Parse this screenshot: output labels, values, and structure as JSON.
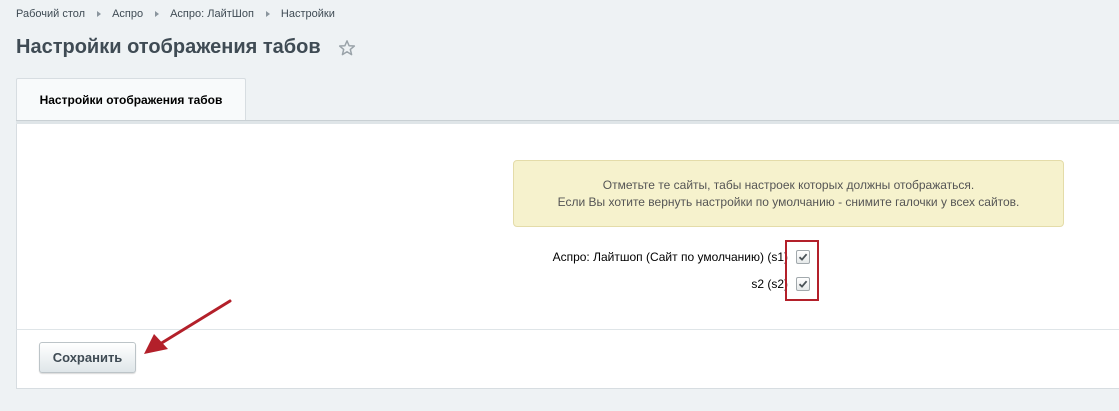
{
  "breadcrumb": {
    "items": [
      "Рабочий стол",
      "Аспро",
      "Аспро: ЛайтШоп",
      "Настройки"
    ]
  },
  "page": {
    "title": "Настройки отображения табов",
    "favorite_icon": "star-icon"
  },
  "tabs": [
    {
      "label": "Настройки отображения табов",
      "active": true
    }
  ],
  "notice": {
    "line1": "Отметьте те сайты, табы настроек которых должны отображаться.",
    "line2": "Если Вы хотите вернуть настройки по умолчанию - снимите галочки у всех сайтов."
  },
  "sites": [
    {
      "label": "Аспро: Лайтшоп (Сайт по умолчанию) (s1)",
      "checked": true
    },
    {
      "label": "s2 (s2)",
      "checked": true
    }
  ],
  "footer": {
    "save_label": "Сохранить"
  },
  "annotations": {
    "highlight_color": "#b3202a",
    "arrow_icon": "red-arrow-icon"
  },
  "colors": {
    "background": "#eef2f4",
    "notice_background": "#f6f2cd",
    "title_text": "#3f4b54"
  }
}
